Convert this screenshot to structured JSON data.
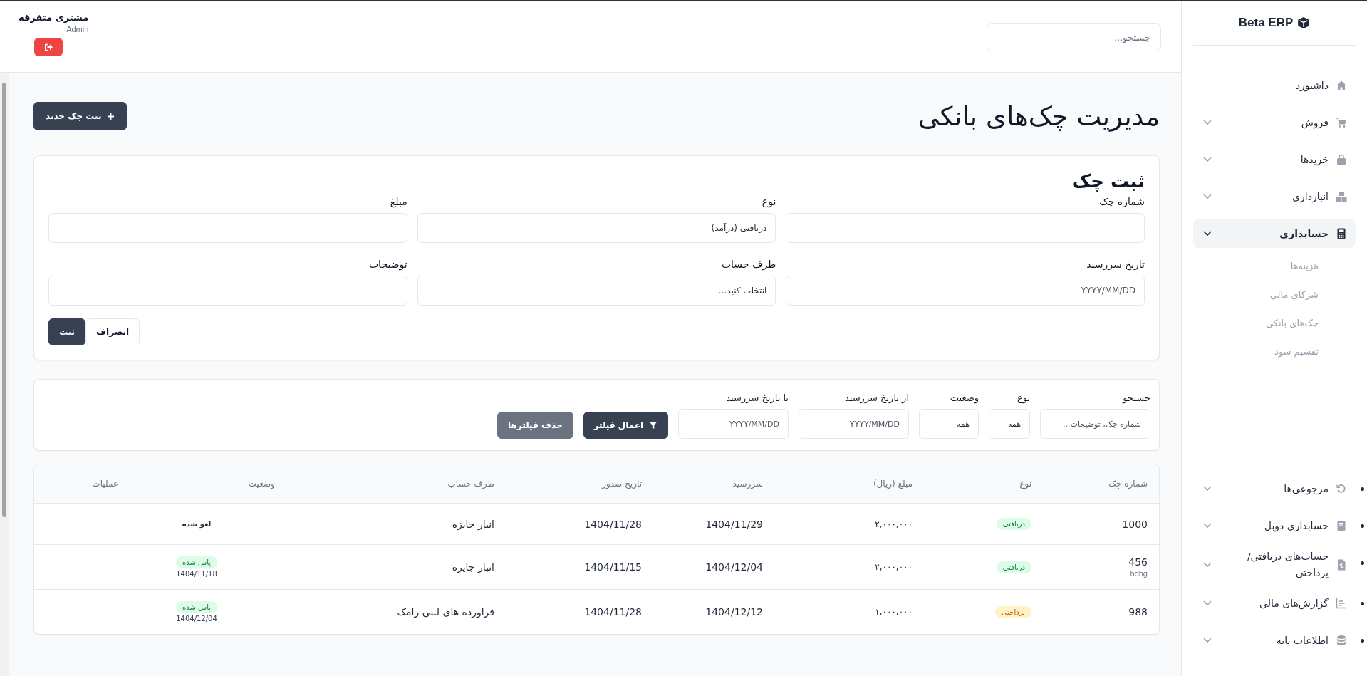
{
  "sidebar": {
    "logo": "Beta ERP",
    "items": [
      {
        "label": "داشبورد",
        "kind": "link",
        "selected": false
      },
      {
        "label": "فروش",
        "kind": "menu",
        "selected": false,
        "expanded": false
      },
      {
        "label": "خریدها",
        "kind": "menu",
        "selected": false,
        "expanded": false
      },
      {
        "label": "انبارداری",
        "kind": "menu",
        "selected": false,
        "expanded": false
      },
      {
        "label": "حسابداری",
        "kind": "menu",
        "selected": true,
        "expanded": true,
        "children": [
          {
            "label": "هزینه‌ها"
          },
          {
            "label": "شرکای مالی"
          },
          {
            "label": "چک‌های بانکی"
          },
          {
            "label": "تقسیم سود"
          }
        ]
      }
    ],
    "more_items": [
      {
        "label": "مرجوعی‌ها",
        "expanded": false
      },
      {
        "label": "حسابداری دوبل",
        "expanded": false
      },
      {
        "label": "حساب‌های دریافتی/ پرداختی",
        "expanded": false
      },
      {
        "label": "گزارش‌های مالی",
        "expanded": false
      },
      {
        "label": "اطلاعات پایه",
        "expanded": false
      }
    ]
  },
  "header": {
    "search": {
      "placeholder": "جستجو..."
    },
    "user": {
      "name": "مشتری متفرقه",
      "role": "Admin"
    }
  },
  "page": {
    "title": "مدیریت چک‌های بانکی",
    "new_button": "ثبت چک جدید"
  },
  "form": {
    "title": "ثبت چک",
    "fields": [
      {
        "label": "شماره چک",
        "kind": "input"
      },
      {
        "label": "نوع",
        "kind": "select",
        "value": "دریافتی (درآمد)"
      },
      {
        "label": "مبلغ",
        "kind": "input"
      },
      {
        "label": "تاریخ سررسید",
        "kind": "input",
        "placeholder": "YYYY/MM/DD"
      },
      {
        "label": "طرف حساب",
        "kind": "select",
        "value": "انتخاب کنید..."
      },
      {
        "label": "توضیحات",
        "kind": "input"
      }
    ],
    "buttons": [
      {
        "label": "انصراف",
        "kind": "secondary"
      },
      {
        "label": "ثبت",
        "kind": "primary"
      }
    ]
  },
  "filters": {
    "fields": [
      {
        "label": "جستجو",
        "kind": "input",
        "placeholder": "شماره چک، توضیحات..."
      },
      {
        "label": "نوع",
        "kind": "select",
        "value": "همه"
      },
      {
        "label": "وضعیت",
        "kind": "select",
        "value": "همه"
      },
      {
        "label": "از تاریخ سررسید",
        "kind": "input",
        "placeholder": "YYYY/MM/DD"
      },
      {
        "label": "تا تاریخ سررسید",
        "kind": "input",
        "placeholder": "YYYY/MM/DD"
      }
    ],
    "buttons": [
      {
        "label": "اعمال فیلتر",
        "kind": "primary"
      },
      {
        "label": "حذف فیلترها",
        "kind": "muted"
      }
    ]
  },
  "table": {
    "columns": [
      "شماره چک",
      "نوع",
      "مبلغ (ریال)",
      "سررسید",
      "تاریخ صدور",
      "طرف حساب",
      "وضعیت",
      "عملیات"
    ],
    "rows": [
      {
        "number": "1000",
        "type": {
          "label": "دریافتی",
          "kind": "received"
        },
        "amount": "۲,۰۰۰,۰۰۰",
        "due": "1404/11/29",
        "issued": "1404/11/28",
        "party": "انبار جایزه",
        "status": {
          "label": "لغو شده",
          "kind": "cancelled"
        }
      },
      {
        "number": "456",
        "note": "hdhg",
        "type": {
          "label": "دریافتی",
          "kind": "received"
        },
        "amount": "۲,۰۰۰,۰۰۰",
        "due": "1404/12/04",
        "issued": "1404/11/15",
        "party": "انبار جایزه",
        "status": {
          "label": "پاس شده",
          "kind": "passed",
          "date": "1404/11/18"
        }
      },
      {
        "number": "988",
        "type": {
          "label": "پرداختی",
          "kind": "paid"
        },
        "amount": "۱,۰۰۰,۰۰۰",
        "due": "1404/12/12",
        "issued": "1404/11/28",
        "party": "فراورده های لبنی رامک",
        "status": {
          "label": "پاس شده",
          "kind": "passed",
          "date": "1404/12/04"
        }
      }
    ]
  }
}
